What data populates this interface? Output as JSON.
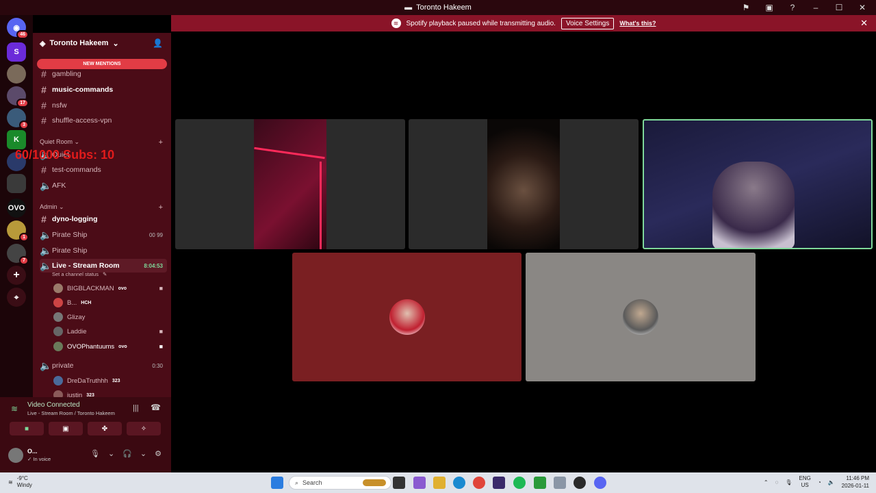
{
  "window": {
    "title": "Toronto Hakeem"
  },
  "notice": {
    "text": "Spotify playback paused while transmitting audio.",
    "button": "Voice Settings",
    "link": "What's this?"
  },
  "rail": {
    "badges": [
      "46",
      "17",
      "3",
      "1",
      "7"
    ]
  },
  "server": {
    "name": "Toronto Hakeem",
    "new_mentions": "NEW MENTIONS"
  },
  "channels": {
    "top": [
      "gambling",
      "music-commands",
      "nsfw",
      "shuffle-access-vpn"
    ],
    "quiet_room_label": "Quiet Room",
    "quiet_room": [
      "Quiet",
      "test-commands",
      "AFK"
    ],
    "admin_label": "Admin",
    "admin": [
      "dyno-logging",
      "Pirate Ship",
      "Pirate Ship"
    ],
    "pirate_meta": [
      "00",
      "99"
    ],
    "live_room": "Live - Stream Room",
    "live_time": "8:04:53",
    "live_status": "Set a channel status",
    "live_members": [
      {
        "name": "BIGBLACKMAN",
        "tag": "ovo"
      },
      {
        "name": "B...",
        "tag": "HCH"
      },
      {
        "name": "Glizay",
        "tag": ""
      },
      {
        "name": "Laddie",
        "tag": ""
      },
      {
        "name": "OVOPhantuums",
        "tag": "ovo"
      }
    ],
    "private_room": "private",
    "private_time": "0:30",
    "private_members": [
      {
        "name": "DreDaTruthhh",
        "tag": "323"
      },
      {
        "name": "justin",
        "tag": "323"
      }
    ]
  },
  "overlay": {
    "subs_text": "60/1000  Subs: 10"
  },
  "voice_panel": {
    "status": "Video Connected",
    "location": "Live - Stream Room / Toronto Hakeem"
  },
  "user": {
    "name": "O...",
    "status": "In voice"
  },
  "taskbar": {
    "weather_temp": "-9°C",
    "weather_desc": "Windy",
    "search_placeholder": "Search",
    "lang1": "ENG",
    "lang2": "US",
    "time": "11:46 PM",
    "date": "2026-01-11"
  },
  "colors": {
    "accent": "#e23c45",
    "sidebar": "#4b0c17",
    "notice": "#8a1428",
    "tile_red": "#7a1f22",
    "tile_gray": "#8a8784",
    "speaking_border": "#7fd99a"
  }
}
